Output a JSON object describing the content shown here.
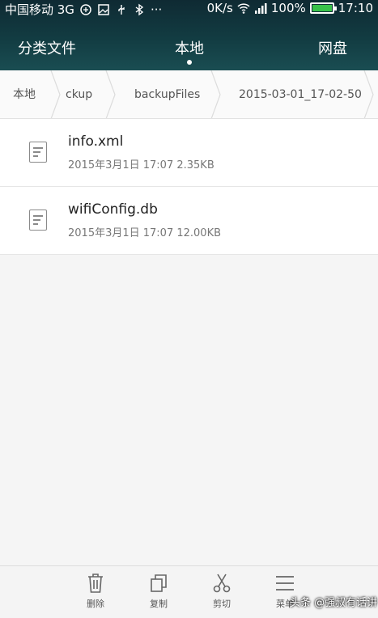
{
  "status_bar": {
    "carrier": "中国移动 3G",
    "speed": "0K/s",
    "battery": "100%",
    "battery_level": 1.0,
    "time": "17:10"
  },
  "tabs": [
    "分类文件",
    "本地",
    "网盘"
  ],
  "active_tab": "本地",
  "breadcrumbs": [
    "本地",
    "ckup",
    "backupFiles",
    "2015-03-01_17-02-50"
  ],
  "files": [
    {
      "name": "info.xml",
      "meta": "2015年3月1日 17:07 2.35KB",
      "icon": "document-icon"
    },
    {
      "name": "wifiConfig.db",
      "meta": "2015年3月1日 17:07 12.00KB",
      "icon": "document-icon"
    }
  ],
  "actions": [
    {
      "label": "删除",
      "icon": "trash-icon"
    },
    {
      "label": "复制",
      "icon": "copy-icon"
    },
    {
      "label": "剪切",
      "icon": "scissors-icon"
    },
    {
      "label": "菜单",
      "icon": "menu-icon"
    }
  ],
  "watermark": "头条 @强叔有话讲",
  "colors": {
    "header_bg": "#123c42",
    "battery_fill": "#38c24a"
  }
}
